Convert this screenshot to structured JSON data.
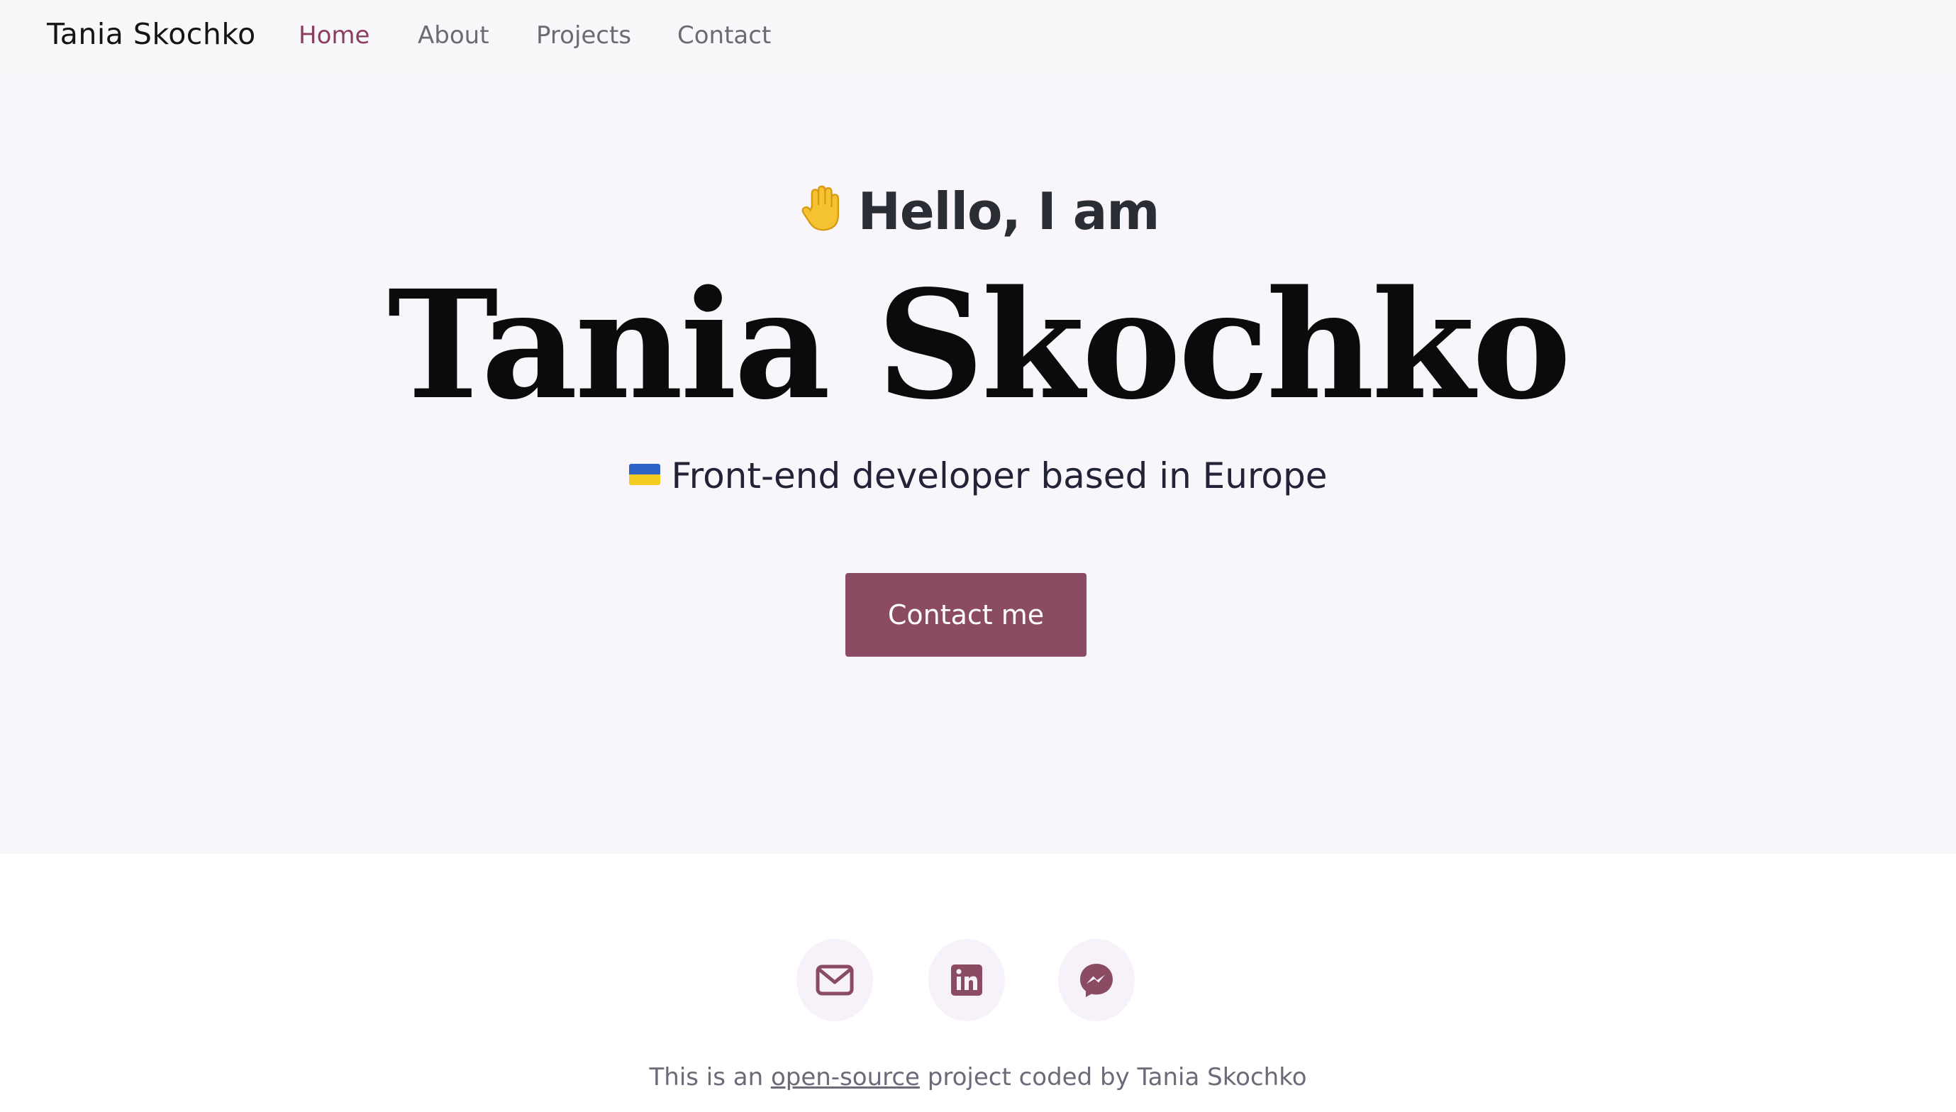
{
  "nav": {
    "brand": "Tania Skochko",
    "links": [
      {
        "label": "Home",
        "active": true
      },
      {
        "label": "About",
        "active": false
      },
      {
        "label": "Projects",
        "active": false
      },
      {
        "label": "Contact",
        "active": false
      }
    ]
  },
  "hero": {
    "greeting": "Hello, I am",
    "greeting_icon": "waving-hand-icon",
    "name": "Tania Skochko",
    "tagline": "Front-end developer based in Europe",
    "tagline_icon": "ukraine-flag-icon",
    "cta_label": "Contact me"
  },
  "footer": {
    "social": [
      {
        "icon": "envelope-icon"
      },
      {
        "icon": "linkedin-icon"
      },
      {
        "icon": "messenger-icon"
      }
    ],
    "text_prefix": "This is an",
    "link_text": "open-source",
    "text_suffix": "project coded by Tania Skochko"
  },
  "colors": {
    "accent": "#8a4b63",
    "hero_background": "#f8f5fb",
    "nav_background": "#f8f8fa"
  }
}
